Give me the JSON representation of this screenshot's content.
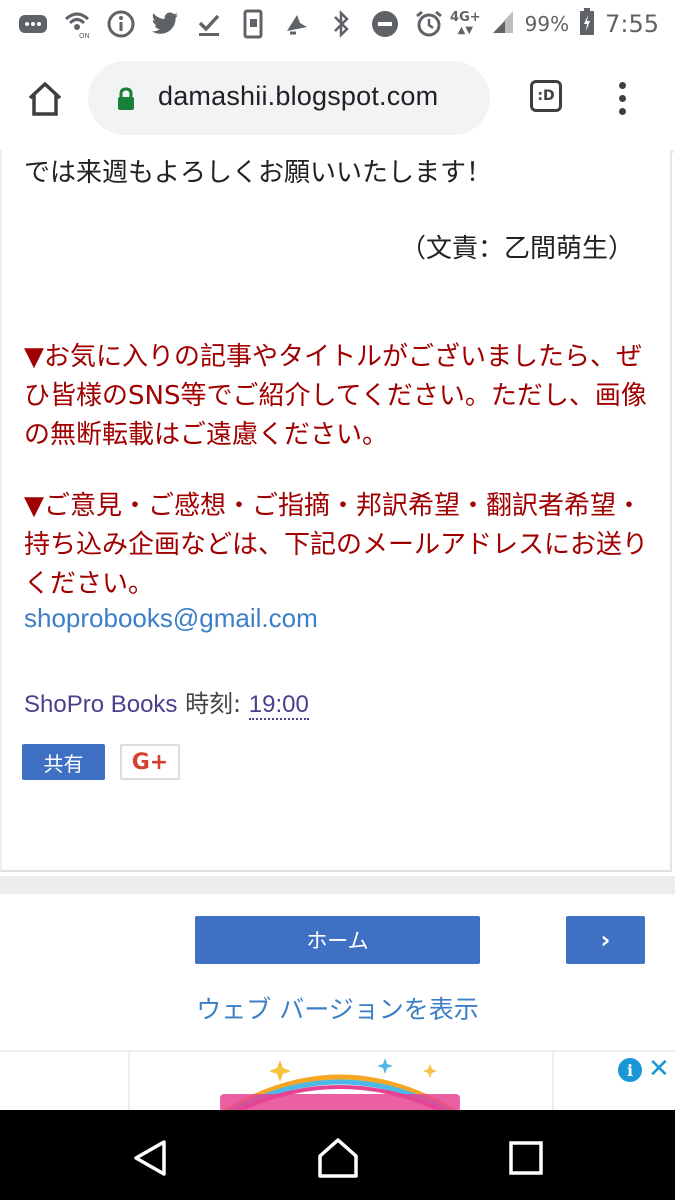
{
  "status_bar": {
    "network": "4G+",
    "battery": "99%",
    "time": "7:55"
  },
  "browser": {
    "url": "damashii.blogspot.com",
    "tab_switcher_label": ":D"
  },
  "article": {
    "closing_line": "では来週もよろしくお願いいたします！",
    "credit": "（文責：乙間萌生）",
    "notice_1": "▼お気に入りの記事やタイトルがございましたら、ぜひ皆様のSNS等でご紹介してください。ただし、画像の無断転載はご遠慮ください。",
    "notice_2": "▼ご意見・ご感想・ご指摘・邦訳希望・翻訳者希望・持ち込み企画などは、下記のメールアドレスにお送りください。",
    "email": "shoprobooks@gmail.com",
    "author": "ShoPro Books",
    "time_label": "時刻:",
    "time_value": "19:00",
    "share_label": "共有",
    "gplus_label": "G+"
  },
  "navigation": {
    "home_label": "ホーム",
    "next_label": "›",
    "web_version_label": "ウェブ バージョンを表示"
  },
  "ad": {
    "info_label": "i",
    "close_label": "✕"
  },
  "colors": {
    "accent_blue": "#3e71c4",
    "link_blue": "#3d7fc6",
    "notice_red": "#a00000"
  }
}
